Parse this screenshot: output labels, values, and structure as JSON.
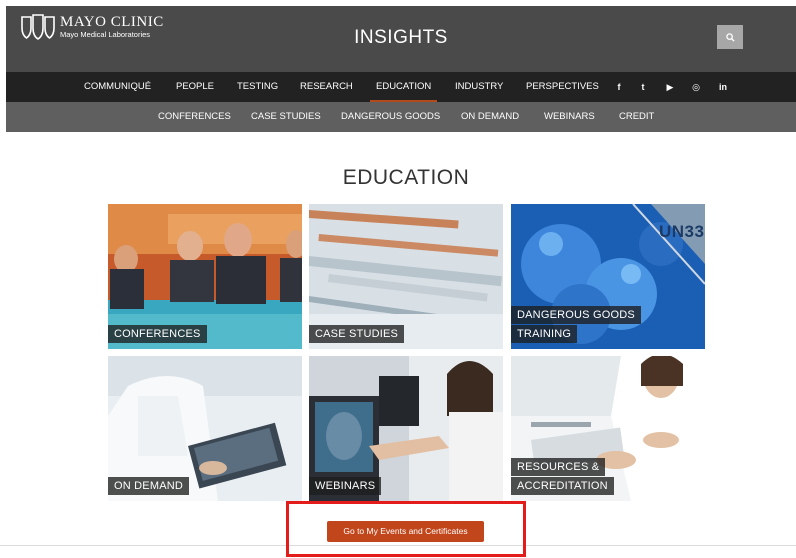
{
  "header": {
    "logo_name": "MAYO CLINIC",
    "logo_sub": "Mayo Medical Laboratories",
    "site_title": "INSIGHTS",
    "search_icon": "search-icon"
  },
  "nav": {
    "items": [
      {
        "label": "COMMUNIQUÉ"
      },
      {
        "label": "PEOPLE"
      },
      {
        "label": "TESTING"
      },
      {
        "label": "RESEARCH"
      },
      {
        "label": "EDUCATION",
        "active": true
      },
      {
        "label": "INDUSTRY"
      },
      {
        "label": "PERSPECTIVES"
      }
    ],
    "social": [
      {
        "icon": "facebook-icon",
        "glyph": "f"
      },
      {
        "icon": "twitter-icon",
        "glyph": "t"
      },
      {
        "icon": "youtube-icon",
        "glyph": "▶"
      },
      {
        "icon": "instagram-icon",
        "glyph": "◎"
      },
      {
        "icon": "linkedin-icon",
        "glyph": "in"
      }
    ]
  },
  "subnav": {
    "items": [
      {
        "label": "CONFERENCES"
      },
      {
        "label": "CASE STUDIES"
      },
      {
        "label": "DANGEROUS GOODS"
      },
      {
        "label": "ON DEMAND"
      },
      {
        "label": "WEBINARS"
      },
      {
        "label": "CREDIT"
      }
    ]
  },
  "main": {
    "title": "EDUCATION",
    "tiles": [
      {
        "label": "CONFERENCES"
      },
      {
        "label": "CASE STUDIES"
      },
      {
        "label": "DANGEROUS GOODS",
        "label2": "TRAINING",
        "image_text": "UN33"
      },
      {
        "label": "ON DEMAND"
      },
      {
        "label": "WEBINARS"
      },
      {
        "label": "RESOURCES &",
        "label2": "ACCREDITATION"
      }
    ],
    "cta_label": "Go to My Events and Certificates"
  },
  "colors": {
    "header_bg": "#4a4a4a",
    "nav_bg": "#222222",
    "subnav_bg": "#5f5f5f",
    "accent": "#c2461b",
    "highlight_frame": "#e31b1b"
  }
}
